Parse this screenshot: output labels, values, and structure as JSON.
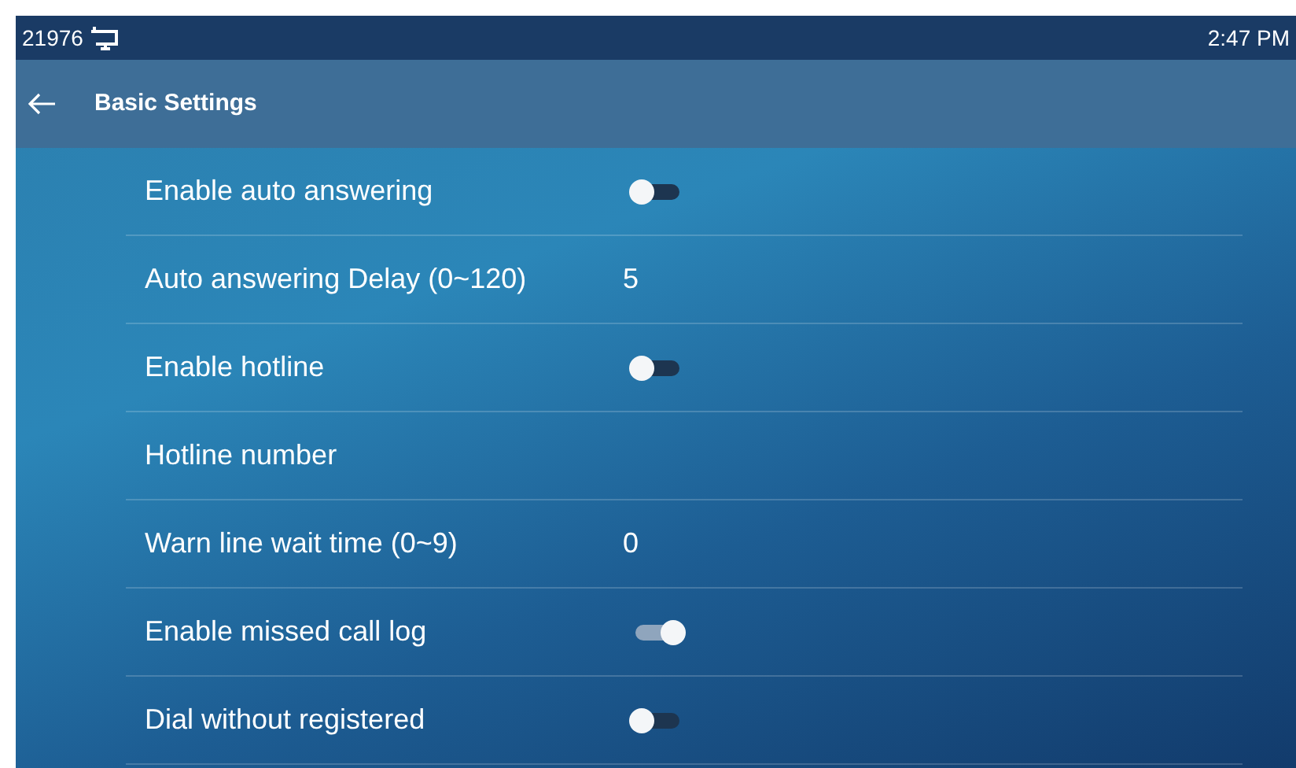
{
  "status_bar": {
    "extension": "21976",
    "time": "2:47 PM"
  },
  "title_bar": {
    "title": "Basic Settings"
  },
  "settings": [
    {
      "label": "Enable auto answering",
      "kind": "switch",
      "on": false
    },
    {
      "label": "Auto answering Delay (0~120)",
      "kind": "value",
      "value": "5"
    },
    {
      "label": "Enable hotline",
      "kind": "switch",
      "on": false
    },
    {
      "label": "Hotline number",
      "kind": "value"
    },
    {
      "label": "Warn line wait time (0~9)",
      "kind": "value",
      "value": "0"
    },
    {
      "label": "Enable missed call log",
      "kind": "switch",
      "on": true
    },
    {
      "label": "Dial without registered",
      "kind": "switch",
      "on": false
    }
  ]
}
